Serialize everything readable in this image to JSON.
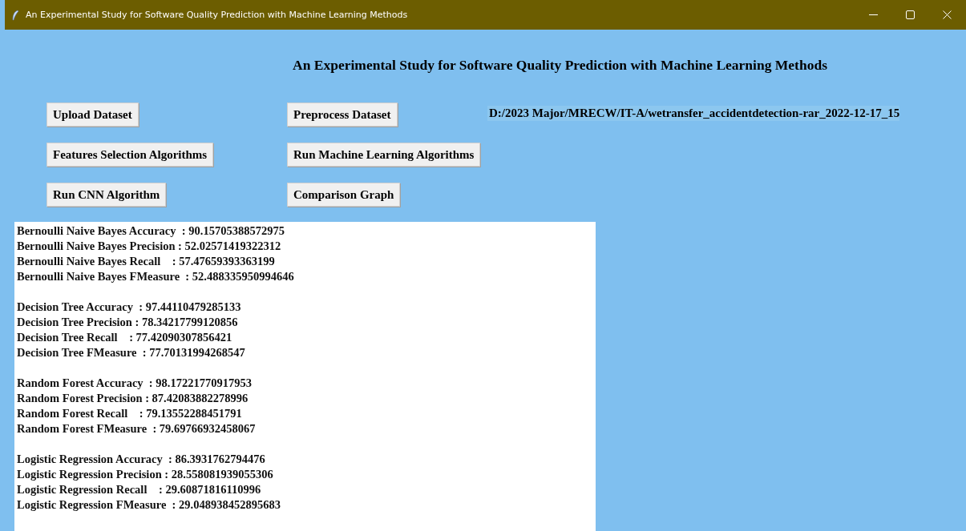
{
  "window": {
    "title": "An Experimental Study for Software Quality Prediction with Machine Learning Methods"
  },
  "heading": "An Experimental Study for Software Quality Prediction with Machine Learning Methods",
  "buttons": [
    [
      "Upload Dataset",
      "Preprocess Dataset"
    ],
    [
      "Features Selection Algorithms",
      "Run Machine Learning Algorithms"
    ],
    [
      "Run CNN Algorithm",
      "Comparison Graph"
    ]
  ],
  "path_label": "D:/2023 Major/MRECW/IT-A/wetransfer_accidentdetection-rar_2022-12-17_15",
  "output": [
    [
      "Bernoulli Naive Bayes Accuracy  : 90.15705388572975",
      "Bernoulli Naive Bayes Precision : 52.02571419322312",
      "Bernoulli Naive Bayes Recall    : 57.47659393363199",
      "Bernoulli Naive Bayes FMeasure  : 52.488335950994646"
    ],
    [
      "Decision Tree Accuracy  : 97.44110479285133",
      "Decision Tree Precision : 78.34217799120856",
      "Decision Tree Recall    : 77.42090307856421",
      "Decision Tree FMeasure  : 77.70131994268547"
    ],
    [
      "Random Forest Accuracy  : 98.17221770917953",
      "Random Forest Precision : 87.42083882278996",
      "Random Forest Recall    : 79.13552288451791",
      "Random Forest FMeasure  : 79.69766932458067"
    ],
    [
      "Logistic Regression Accuracy  : 86.3931762794476",
      "Logistic Regression Precision : 28.558081939055306",
      "Logistic Regression Recall    : 29.60871816110996",
      "Logistic Regression FMeasure  : 29.048938452895683"
    ]
  ]
}
